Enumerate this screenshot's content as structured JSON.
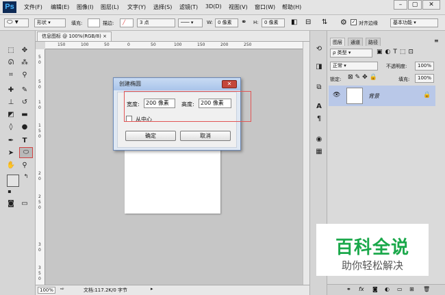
{
  "app": {
    "logo": "Ps"
  },
  "menu": [
    "文件(F)",
    "编辑(E)",
    "图像(I)",
    "图层(L)",
    "文字(Y)",
    "选择(S)",
    "滤镜(T)",
    "3D(D)",
    "视图(V)",
    "窗口(W)",
    "帮助(H)"
  ],
  "window_controls": {
    "minimize": "–",
    "restore": "▢",
    "close": "✕"
  },
  "options": {
    "shape_mode": "形状",
    "fill_label": "填充:",
    "stroke_label": "描边:",
    "stroke_size": "3 点",
    "w_label": "W:",
    "w_value": "0 像素",
    "h_label": "H:",
    "h_value": "0 像素",
    "align_edges": "对齐边缘",
    "workspace": "基本功能"
  },
  "document": {
    "tab_title": "信息图标 @ 100%(RGB/8)",
    "tab_close": "×",
    "zoom": "100%",
    "status": "文档:117.2K/0 字节"
  },
  "rulers": {
    "top": [
      "150",
      "100",
      "50",
      "0",
      "50",
      "100",
      "150",
      "200",
      "250"
    ],
    "left": [
      "5",
      "0",
      "5",
      "0",
      "1",
      "0",
      "1",
      "5",
      "0",
      "2",
      "0",
      "2",
      "5",
      "0",
      "3",
      "0",
      "3",
      "5",
      "0"
    ]
  },
  "dialog": {
    "title": "创建椭圆",
    "close": "✕",
    "width_label": "宽度:",
    "width_value": "200 像素",
    "height_label": "高度:",
    "height_value": "200 像素",
    "from_center_label": "从中心",
    "ok": "确定",
    "cancel": "取消"
  },
  "panel": {
    "tabs": [
      "图层",
      "通道",
      "路径"
    ],
    "filter_label": "ρ 类型",
    "blend_mode": "正常",
    "opacity_label": "不透明度:",
    "opacity_value": "100%",
    "lock_label": "锁定:",
    "fill_label": "填充:",
    "fill_value": "100%",
    "layer_name": "背景"
  },
  "watermark": {
    "title": "百科全说",
    "subtitle": "助你轻松解决"
  },
  "colors": {
    "accent": "#1aa84a",
    "dialog_border": "#6b88b5",
    "highlight": "#e25454",
    "layer_selected": "#b9c8e8"
  }
}
